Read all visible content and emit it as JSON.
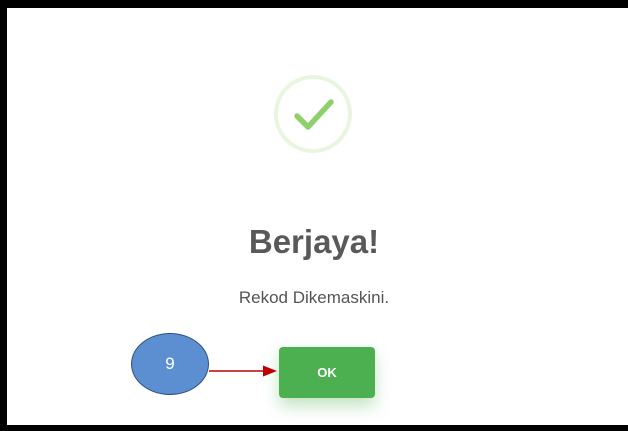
{
  "dialog": {
    "icon": "checkmark-icon",
    "title": "Berjaya!",
    "message": "Rekod Dikemaskini.",
    "ok_label": "OK"
  },
  "annotation": {
    "step_number": "9"
  },
  "colors": {
    "accent_green": "#4caf50",
    "check_green": "#a5dc86",
    "annotation_blue": "#5b8fd1",
    "arrow_red": "#c00000"
  }
}
